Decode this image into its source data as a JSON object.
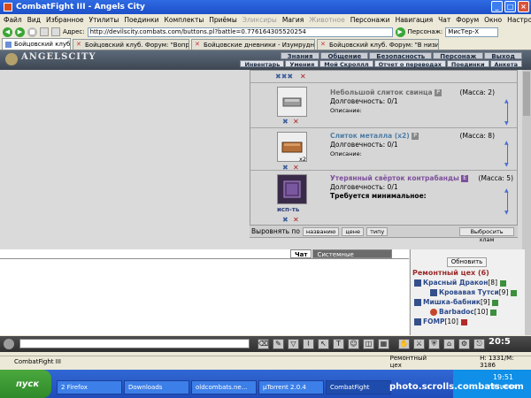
{
  "window": {
    "title": "CombatFight III - Angels City"
  },
  "menu": {
    "items": [
      "Файл",
      "Вид",
      "Избранное",
      "Утилиты",
      "Поединки",
      "Комплекты",
      "Приёмы",
      "Эликсиры",
      "Магия",
      "Животное",
      "Персонажи",
      "Навигация",
      "Чат",
      "Форум",
      "Окно",
      "Настройки",
      "?"
    ]
  },
  "address": {
    "label": "Адрес:",
    "url": "http://devilscity.combats.com/buttons.pl?battle=0.776164305520254",
    "char_label": "Персонаж:",
    "char_value": "МисТер-Х"
  },
  "tabs": [
    {
      "label": "Бойцовский клуб"
    },
    {
      "label": "Бойцовский клуб. Форум: \"Вопрос к..."
    },
    {
      "label": "Бойцовские дневники - Изумрудная..."
    },
    {
      "label": "Бойцовский клуб. Форум: \"В низина..."
    }
  ],
  "game": {
    "logo": "ANGELSCITY",
    "topnav": [
      "Знания",
      "Общение",
      "Безопасность",
      "Персонаж",
      "Выход"
    ],
    "subnav": [
      "Инвентарь",
      "Умения",
      "Мой Скроллл",
      "Отчет о переводах",
      "Поединки",
      "Анкета"
    ],
    "items": [
      {
        "name": "Небольшой слиток свинца",
        "mass": "(Масса: 2)",
        "durability": "Долговечность: 0/1",
        "desc": "Описание:"
      },
      {
        "name": "Слиток металла (x2)",
        "mass": "(Масса: 8)",
        "durability": "Долговечность: 0/1",
        "desc": "Описание:",
        "count": "x2"
      },
      {
        "name": "Утерянный свёрток контрабанды",
        "mass": "(Масса: 5)",
        "durability": "Долговечность: 0/1",
        "note": "Требуется минимальное:",
        "use_label": "исп-ть"
      }
    ],
    "sort": {
      "label": "Выровнять по",
      "by_name": "названию",
      "by_price": "цене",
      "by_type": "типу",
      "discard": "Выбросить хлам"
    }
  },
  "chat": {
    "tab_chat": "Чат",
    "tab_system": "Системные сообщения"
  },
  "sidebar": {
    "refresh": "Обновить",
    "group": "Ремонтный цех (6)",
    "users": [
      {
        "name": "Красный Дракон",
        "level": "[8]"
      },
      {
        "name": "Кровавая Тутси",
        "level": "[9]"
      },
      {
        "name": "Мишка-бабник",
        "level": "[9]"
      },
      {
        "name": "Barbadoc",
        "level": "[10]"
      },
      {
        "name": "FOMP",
        "level": "[10]"
      }
    ]
  },
  "toolbar": {
    "clock": "20:5"
  },
  "status": {
    "left": "CombatFight III",
    "middle": "Ремонтный цех",
    "right": "H: 1331/M: 3186"
  },
  "taskbar": {
    "start": "пуск",
    "tasks": [
      "2 Firefox",
      "Downloads",
      "oldcombats.ne...",
      "µTorrent 2.0.4",
      "CombatFight"
    ],
    "time": "19:51",
    "day": "пятница"
  },
  "watermark": "photo.scrolls.combats.com"
}
